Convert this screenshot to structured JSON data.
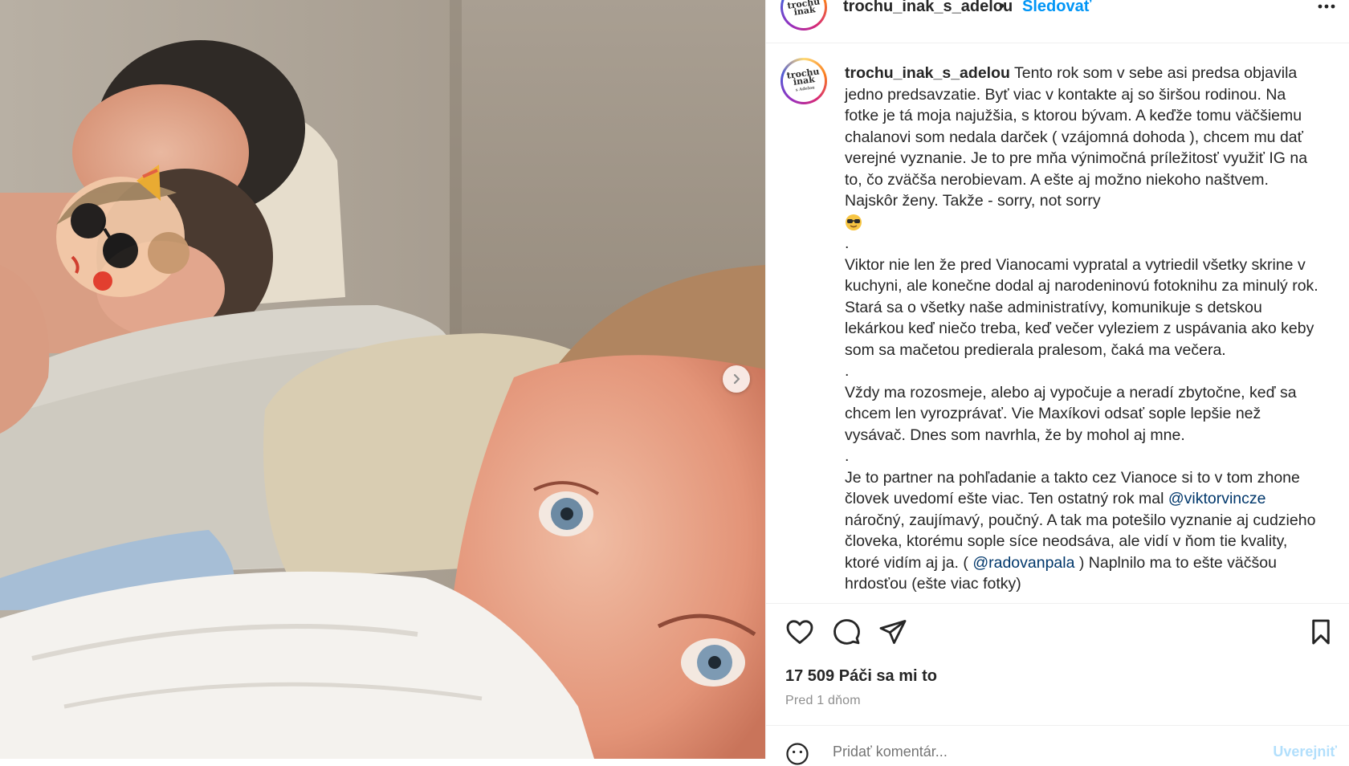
{
  "post": {
    "username": "trochu_inak_s_adelou",
    "separator": "•",
    "follow_label": "Sledovať",
    "more_icon": "more-horizontal-icon",
    "avatar_logo": [
      "trochu",
      "inak",
      "s Adelou"
    ],
    "caption": {
      "p1": "Tento rok som v sebe asi predsa objavila jedno predsavzatie. Byť viac v kontakte aj so širšou rodinou. Na fotke je tá moja najužšia, s ktorou bývam. A keďže tomu väčšiemu chalanovi som nedala darček ( vzájomná dohoda ), chcem mu dať verejné vyznanie. Je to pre mňa výnimočná príležitosť využiť IG na to, čo zväčša nerobievam. A ešte aj možno niekoho naštvem. Najskôr ženy. Takže - sorry, not sorry",
      "dot1": ".",
      "p2": "Viktor nie len že pred Vianocami vypratal a vytriedil všetky skrine v kuchyni, ale konečne dodal aj narodeninovú fotoknihu za minulý rok. Stará sa o všetky naše administratívy, komunikuje s detskou lekárkou keď niečo treba, keď večer vyleziem z uspávania ako keby som sa mačetou predierala pralesom, čaká ma večera.",
      "dot2": ".",
      "p3": "Vždy ma rozosmeje, alebo aj vypočuje a neradí zbytočne, keď sa chcem len vyrozprávať. Vie Maxíkovi odsať sople lepšie než vysávač. Dnes som navrhla, že by mohol aj mne.",
      "dot3": ".",
      "p4_a": "Je to partner na pohľadanie a takto cez Vianoce si to v tom zhone človek uvedomí ešte viac. Ten ostatný rok mal",
      "mention1": "@viktorvincze",
      "p4_b": "náročný, zaujímavý, poučný. A tak ma potešilo vyznanie aj cudzieho človeka, ktorému sople síce neodsáva, ale vidí v ňom tie kvality, ktoré vidím aj ja. (",
      "mention2": "@radovanpala",
      "p4_c": ") Naplnilo ma to ešte väčšou hrdosťou (ešte viac fotky)",
      "emoji": "cool-face-emoji"
    },
    "actions": {
      "like_icon": "heart-icon",
      "comment_icon": "comment-icon",
      "share_icon": "send-icon",
      "save_icon": "bookmark-icon"
    },
    "likes_text": "17 509 Páči sa mi to",
    "time_text": "Pred 1 dňom",
    "comment": {
      "emoji_icon": "smile-icon",
      "placeholder": "Pridať komentár...",
      "post_label": "Uverejniť"
    },
    "carousel": {
      "next_icon": "chevron-right-icon"
    }
  },
  "colors": {
    "link": "#0095f6",
    "mention": "#00376b",
    "text": "#262626",
    "muted": "#8e8e8e"
  }
}
